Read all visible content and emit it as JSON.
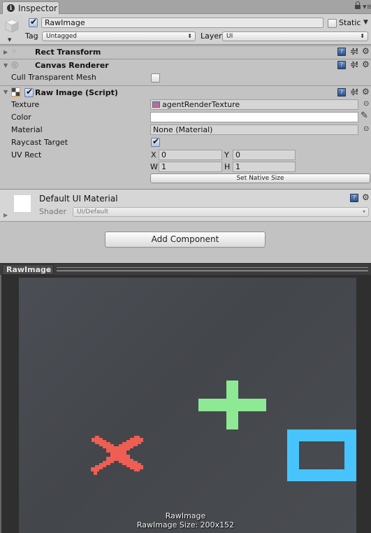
{
  "tab": {
    "label": "Inspector",
    "icon": "info-icon"
  },
  "header": {
    "active": true,
    "name": "RawImage",
    "static_label": "Static",
    "static_checked": false,
    "tag_label": "Tag",
    "tag_value": "Untagged",
    "layer_label": "Layer",
    "layer_value": "UI"
  },
  "components": {
    "rect_transform": {
      "title": "Rect Transform",
      "expanded": false
    },
    "canvas_renderer": {
      "title": "Canvas Renderer",
      "expanded": true,
      "cull_label": "Cull Transparent Mesh",
      "cull_checked": false
    },
    "raw_image": {
      "title": "Raw Image (Script)",
      "expanded": true,
      "enabled": true,
      "texture_label": "Texture",
      "texture_value": "agentRenderTexture",
      "color_label": "Color",
      "color_value": "#FFFFFF",
      "material_label": "Material",
      "material_value": "None (Material)",
      "raycast_label": "Raycast Target",
      "raycast_checked": true,
      "uvrect_label": "UV Rect",
      "uv_x_label": "X",
      "uv_x": "0",
      "uv_y_label": "Y",
      "uv_y": "0",
      "uv_w_label": "W",
      "uv_w": "1",
      "uv_h_label": "H",
      "uv_h": "1",
      "native_size_button": "Set Native Size"
    }
  },
  "material": {
    "name": "Default UI Material",
    "shader_label": "Shader",
    "shader_value": "UI/Default"
  },
  "add_component_button": "Add Component",
  "preview": {
    "selector_label": "RawImage",
    "caption_name": "RawImage",
    "caption_size": "RawImage Size: 200x152",
    "shapes": {
      "cross_color": "#EE5E52",
      "plus_color": "#8EE995",
      "square_color": "#48C4FC"
    }
  }
}
